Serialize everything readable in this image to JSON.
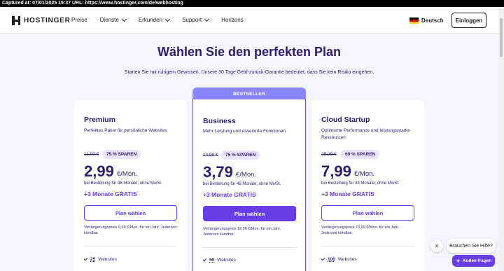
{
  "capture_bar": "Captured at: 07/01/2025 15:37   URL: https://www.hostinger.com/de/webhosting",
  "nav": {
    "logo_text": "HOSTINGER",
    "items": [
      {
        "label": "Preise",
        "has_chevron": false
      },
      {
        "label": "Dienste",
        "has_chevron": true
      },
      {
        "label": "Erkunden",
        "has_chevron": true
      },
      {
        "label": "Support",
        "has_chevron": true
      },
      {
        "label": "Horizons",
        "has_chevron": false
      }
    ],
    "language": "Deutsch",
    "language_icon": "german-flag-icon",
    "login_label": "Einloggen"
  },
  "hero": {
    "title": "Wählen Sie den perfekten Plan",
    "subtitle": "Starten Sie mit ruhigem Gewissen. Unsere 30 Tage Geld-zurück-Garantie bedeutet, dass Sie kein Risiko eingehen."
  },
  "plans": {
    "premium": {
      "name": "Premium",
      "description": "Perfektes Paket für persönliche Websites",
      "old_price": "11,99 €",
      "discount": "75 % SPAREN",
      "price": "2,99",
      "per": "€/Mon.",
      "billing": "bei Bestellung für 48 Monate; ohne MwSt.",
      "bonus": "+3 Monate GRATIS",
      "button": "Plan wählen",
      "renewal": "Verlängerungspreis 9,99 €/Mon. für ein Jahr. Jederzeit kündbar.",
      "feature_count": "25",
      "feature_label": "Websites"
    },
    "business": {
      "ribbon": "BESTSELLER",
      "name": "Business",
      "description": "Mehr Leistung und erweiterte Funktionen",
      "old_price": "14,99 €",
      "discount": "75 % SPAREN",
      "price": "3,79",
      "per": "€/Mon.",
      "billing": "bei Bestellung für 48 Monate; ohne MwSt.",
      "bonus": "+3 Monate GRATIS",
      "button": "Plan wählen",
      "renewal": "Verlängerungspreis 12,99 €/Mon. für ein Jahr. Jederzeit kündbar.",
      "feature_count": "50",
      "feature_label": "Websites"
    },
    "cloud": {
      "name": "Cloud Startup",
      "description": "Optimierte Performance und leistungsstarke Ressourcen",
      "old_price": "25,99 €",
      "discount": "69 % SPAREN",
      "price": "7,99",
      "per": "€/Mon.",
      "billing": "bei Bestellung für 48 Monate; ohne MwSt.",
      "bonus": "+3 Monate GRATIS",
      "button": "Plan wählen",
      "renewal": "Verlängerungspreis 23,99 €/Mon. für ein Jahr. Jederzeit kündbar.",
      "feature_count": "100",
      "feature_label": "Websites"
    }
  },
  "help": {
    "close": "×",
    "bubble": "Brauchen Sie Hilfe?",
    "kodee_label": "Kodee fragen",
    "kodee_icon": "sparkle-icon"
  },
  "colors": {
    "brand": "#673de6",
    "brand_light": "#8c85ff",
    "text": "#2f1c6a",
    "page_bg": "#f4f5ff",
    "badge_bg": "#ebe4ff"
  }
}
